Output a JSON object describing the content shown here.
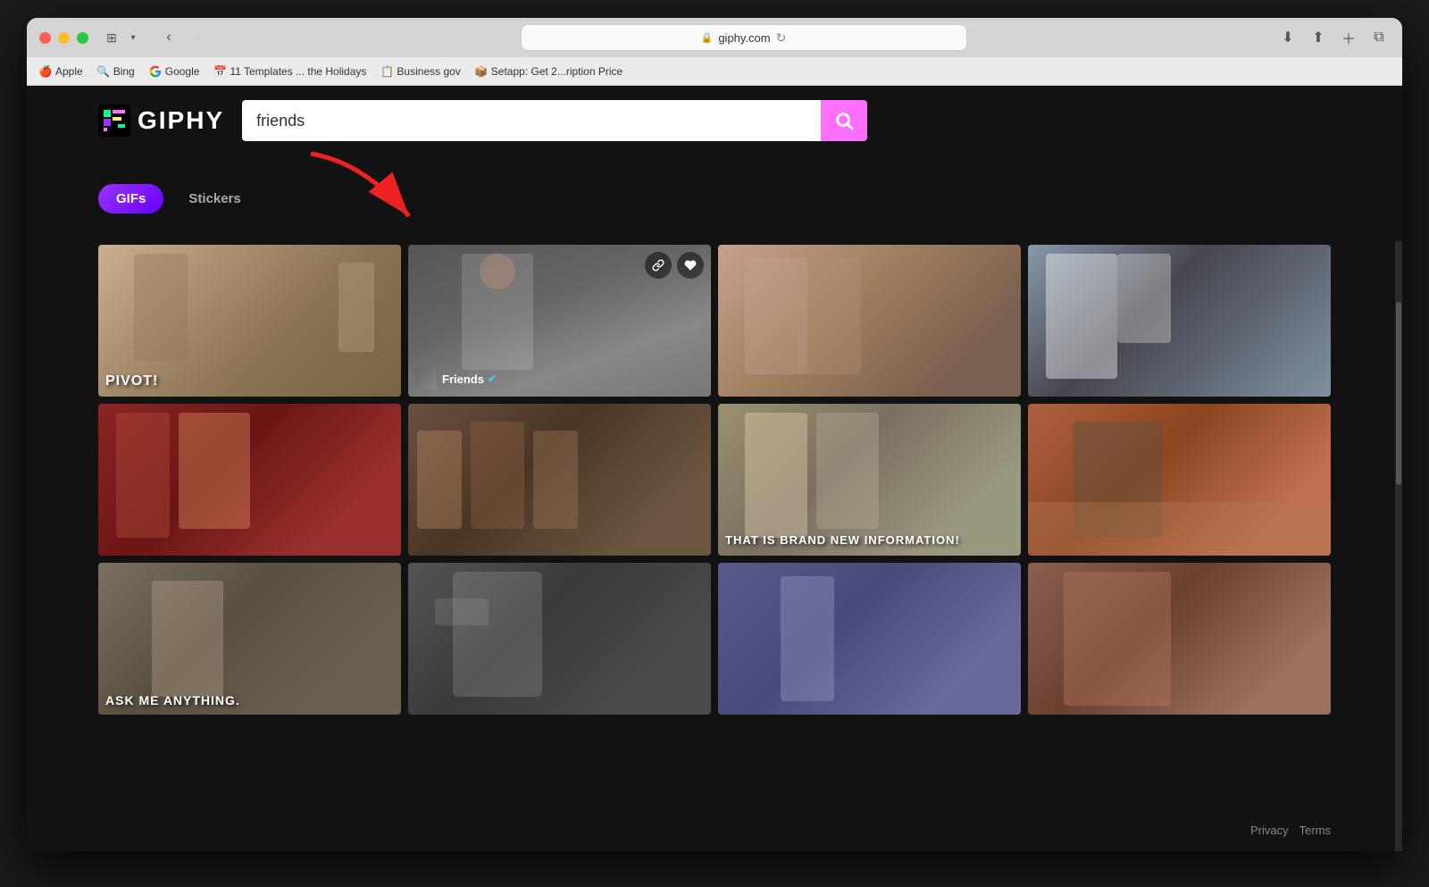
{
  "window": {
    "title": "giphy.com",
    "url": "giphy.com"
  },
  "browser": {
    "bookmarks": [
      {
        "label": "Apple",
        "icon": "🍎"
      },
      {
        "label": "Bing",
        "icon": "🔍"
      },
      {
        "label": "Google",
        "icon": "G"
      },
      {
        "label": "11 Templates ... the Holidays",
        "icon": "📅"
      },
      {
        "label": "Business gov",
        "icon": "📋"
      },
      {
        "label": "Setapp: Get 2...ription Price",
        "icon": "📦"
      }
    ]
  },
  "giphy": {
    "logo_text": "GIPHY",
    "search_placeholder": "friends",
    "search_value": "friends",
    "tabs": [
      {
        "label": "GIFs",
        "active": true
      },
      {
        "label": "Stickers",
        "active": false
      }
    ]
  },
  "gifs": [
    {
      "id": 1,
      "caption": "PIVOT!",
      "bg": "#8B7355",
      "has_channel": false,
      "row": 0,
      "col": 0
    },
    {
      "id": 2,
      "caption": "",
      "bg": "#696969",
      "has_channel": true,
      "channel_name": "Friends",
      "verified": true,
      "show_overlay": true,
      "row": 0,
      "col": 1
    },
    {
      "id": 3,
      "caption": "",
      "bg": "#7B6B5A",
      "has_channel": false,
      "row": 0,
      "col": 2
    },
    {
      "id": 4,
      "caption": "",
      "bg": "#708090",
      "has_channel": false,
      "row": 0,
      "col": 3
    },
    {
      "id": 5,
      "caption": "",
      "bg": "#8B2020",
      "has_channel": false,
      "row": 1,
      "col": 0
    },
    {
      "id": 6,
      "caption": "",
      "bg": "#5C4A3A",
      "has_channel": false,
      "row": 1,
      "col": 1
    },
    {
      "id": 7,
      "caption": "THAT IS BRAND NEW INFORMATION!",
      "bg": "#9B9B7A",
      "has_channel": false,
      "row": 1,
      "col": 2
    },
    {
      "id": 8,
      "caption": "",
      "bg": "#B05A2A",
      "has_channel": false,
      "row": 1,
      "col": 3
    },
    {
      "id": 9,
      "caption": "ASK ME ANYTHING.",
      "bg": "#6B6B6B",
      "has_channel": false,
      "row": 2,
      "col": 0
    },
    {
      "id": 10,
      "caption": "",
      "bg": "#4A4A4A",
      "has_channel": false,
      "row": 2,
      "col": 1
    },
    {
      "id": 11,
      "caption": "",
      "bg": "#5A5A7A",
      "has_channel": false,
      "row": 2,
      "col": 2
    },
    {
      "id": 12,
      "caption": "",
      "bg": "#7A5A4A",
      "has_channel": false,
      "row": 2,
      "col": 3
    }
  ],
  "footer": {
    "privacy_label": "Privacy",
    "terms_label": "Terms"
  },
  "arrow": {
    "color": "#ee2222"
  }
}
